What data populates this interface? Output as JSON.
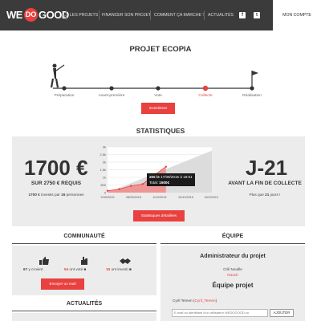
{
  "header": {
    "logo": {
      "we": "WE",
      "do": "DO",
      "good": "GOOD",
      "suffix": ".co"
    },
    "nav": [
      "Les projets",
      "Financer son projet",
      "Comment ça marche ?",
      "Actualités"
    ],
    "social": [
      {
        "icon": "facebook-icon",
        "glyph": "f"
      },
      {
        "icon": "twitter-icon",
        "glyph": "t"
      }
    ],
    "account": "Mon compte",
    "colors": {
      "bar": "#3b3b3b",
      "accent": "#e8413f"
    }
  },
  "project": {
    "title": "Projet ECOPIA",
    "steps": [
      {
        "label": "Préparation",
        "active": false
      },
      {
        "label": "Avant-première",
        "active": false
      },
      {
        "label": "Vote",
        "active": false
      },
      {
        "label": "Collecte",
        "active": true
      },
      {
        "label": "Réalisation",
        "active": false
      }
    ],
    "invest_button": "Investissez"
  },
  "stats": {
    "title": "Statistiques",
    "amount": "1700 €",
    "goal": "sur 2750 € requis",
    "investors_text_amount": "1700 €",
    "investors_text_mid": " investis par ",
    "investors_count": "16",
    "investors_text_end": " personnes",
    "days": "J-21",
    "days_caption": "avant la fin de collecte",
    "days_left_prefix": "Plus que ",
    "days_left_num": "21",
    "days_left_suffix": " jours !",
    "details_button": "Statistiques détaillées"
  },
  "chart_data": {
    "type": "area",
    "x": [
      "2/09/2015",
      "9/09/2015",
      "16/09/2015",
      "23/09/2015",
      "30/09/2015",
      "4/10/2015"
    ],
    "series": [
      {
        "values": [
          120,
          230,
          440,
          560,
          1150,
          1700
        ]
      }
    ],
    "target_line": {
      "from": [
        0,
        2750
      ]
    },
    "x_ticks": [
      "2/09/2015",
      "28/09/2015",
      "4/10/2015",
      "10/10/2015",
      "16/10/2015"
    ],
    "y_ticks": [
      "0",
      "500",
      "1k",
      "1,5k",
      "2k",
      "2,5k",
      "3k"
    ],
    "ylim": [
      0,
      3000
    ],
    "tooltip": {
      "date_prefix": "20€ le ",
      "date": "17/09/2015 à 18:51",
      "total_label": "Total: ",
      "total": "1600€"
    }
  },
  "community": {
    "title": "Communauté",
    "items": [
      {
        "icon": "thumbs-up-icon",
        "count": "67",
        "label": " y croient"
      },
      {
        "icon": "hand-vote-icon",
        "count": "54",
        "label": " ont voté"
      },
      {
        "icon": "handshake-icon",
        "count": "15",
        "label": " ont investi"
      }
    ],
    "link_button": "Envoyer un mail"
  },
  "team": {
    "title": "Équipe",
    "admin_title": "Administrateur du projet",
    "admin_name": "Crili Nouille",
    "admin_login": "Nooch",
    "team_title": "Équipe projet",
    "member_name": "Cyril Temen",
    "member_login": "Cyril_Temen",
    "input_placeholder": "E-mail ou identifiant d'un utilisateur WEDOGOOD.co",
    "add_button": "AJOUTER"
  },
  "news": {
    "title": "Actualités"
  }
}
